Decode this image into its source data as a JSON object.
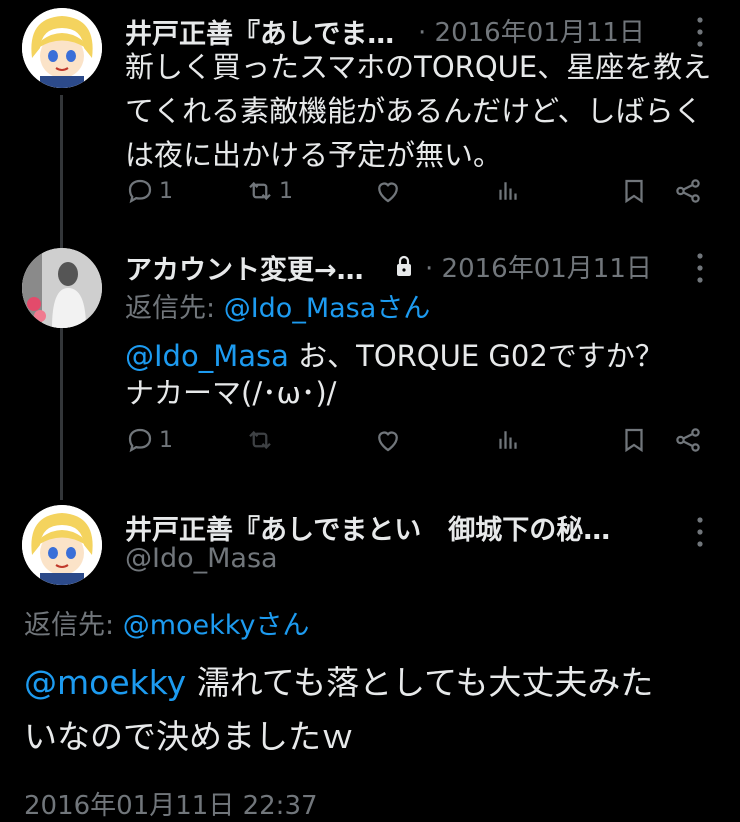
{
  "tweet1": {
    "author": "井戸正善『あしでま…",
    "date": "· 2016年01月11日",
    "text": "新しく買ったスマホのTORQUE、星座を教えてくれる素敵機能があるんだけど、しばらくは夜に出かける予定が無い。",
    "replies": "1",
    "retweets": "1"
  },
  "tweet2": {
    "author": "アカウント変更→…",
    "date": "· 2016年01月11日",
    "reply_to_label": "返信先:",
    "reply_to_handle": "@Ido_Masaさん",
    "mention": "@Ido_Masa",
    "text_line1": " お、TORQUE G02ですか？",
    "text_line2": "ナカーマ(/･ω･)/",
    "replies": "1"
  },
  "tweet3": {
    "author": "井戸正善『あしでまとい　御城下の秘…",
    "handle": "@Ido_Masa",
    "reply_to_label": "返信先:",
    "reply_to_handle": "@moekkyさん",
    "mention": "@moekky",
    "text_line1": " 濡れても落としても大丈夫みた",
    "text_line2": "いなので決めましたｗ",
    "timestamp": "2016年01月11日 22:37"
  },
  "icons": [
    "reply-icon",
    "retweet-icon",
    "like-icon",
    "views-icon",
    "bookmark-icon",
    "share-icon",
    "more-icon",
    "lock-icon"
  ],
  "colors": {
    "background": "#000000",
    "text": "#e7e9ea",
    "secondary": "#71767b",
    "link": "#1d9bf0"
  }
}
